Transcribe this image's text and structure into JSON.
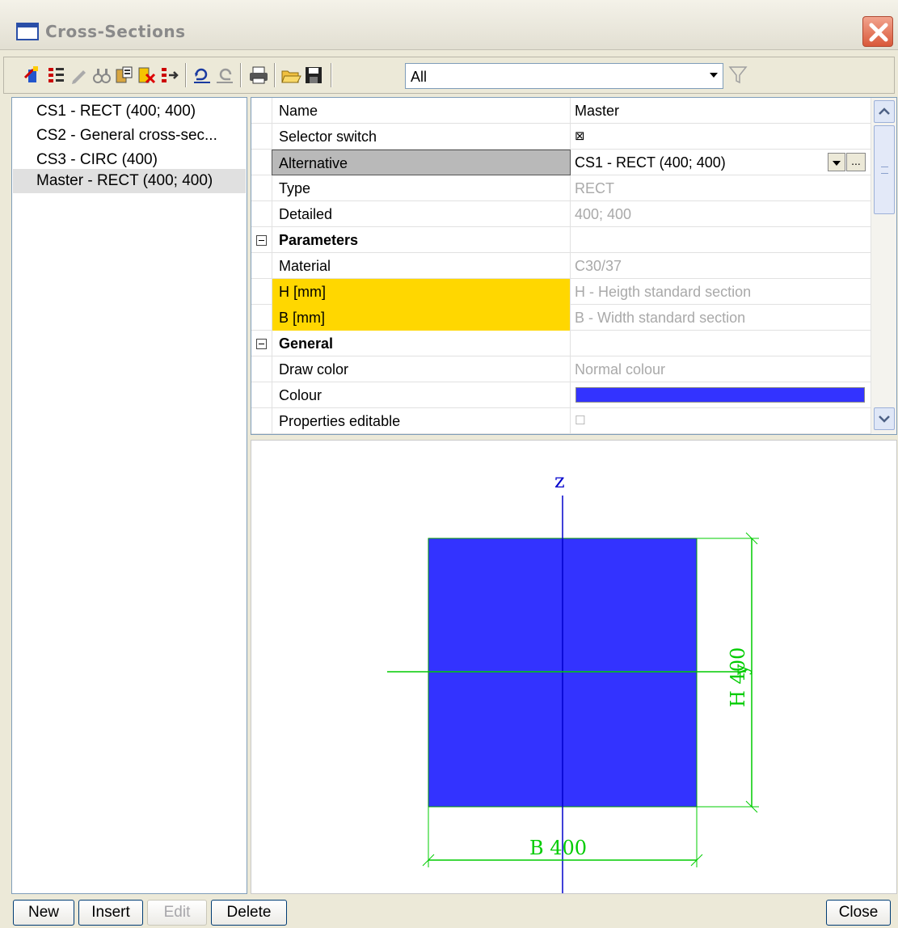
{
  "window": {
    "title": "Cross-Sections"
  },
  "toolbar": {
    "filter_value": "All",
    "icons": [
      "new-icon",
      "properties-icon",
      "edit-icon",
      "find-icon",
      "copy-icon",
      "delete-icon",
      "export-icon",
      "undo-icon",
      "redo-icon",
      "print-icon",
      "open-icon",
      "save-icon",
      "filter-icon"
    ]
  },
  "list": {
    "items": [
      {
        "label": "CS1 - RECT (400; 400)"
      },
      {
        "label": "CS2 - General cross-sec..."
      },
      {
        "label": "CS3 - CIRC (400)"
      },
      {
        "label": "Master - RECT (400; 400)"
      }
    ],
    "selected_index": 3
  },
  "properties": {
    "rows": [
      {
        "label": "Name",
        "value": "Master"
      },
      {
        "label": "Selector switch",
        "value": "⊠"
      },
      {
        "label": "Alternative",
        "value": "CS1 - RECT (400; 400)"
      },
      {
        "label": "Type",
        "value": "RECT"
      },
      {
        "label": "Detailed",
        "value": "400; 400"
      },
      {
        "label": "Parameters",
        "value": ""
      },
      {
        "label": "Material",
        "value": "C30/37"
      },
      {
        "label": "H [mm]",
        "value": "H - Heigth standard section"
      },
      {
        "label": "B [mm]",
        "value": "B - Width standard section"
      },
      {
        "label": "General",
        "value": ""
      },
      {
        "label": "Draw color",
        "value": "Normal colour"
      },
      {
        "label": "Colour",
        "value": ""
      },
      {
        "label": "Properties editable",
        "value": "☐"
      }
    ],
    "combo_ellipsis": "..."
  },
  "preview": {
    "axis_z": "z",
    "axis_y": "y",
    "dim_h": "H 400",
    "dim_b": "B 400",
    "section_color": "#3333ff",
    "dim_color": "#00cc00",
    "axis_color": "#0000cc"
  },
  "buttons": {
    "new": "New",
    "insert": "Insert",
    "edit": "Edit",
    "delete": "Delete",
    "close": "Close"
  }
}
